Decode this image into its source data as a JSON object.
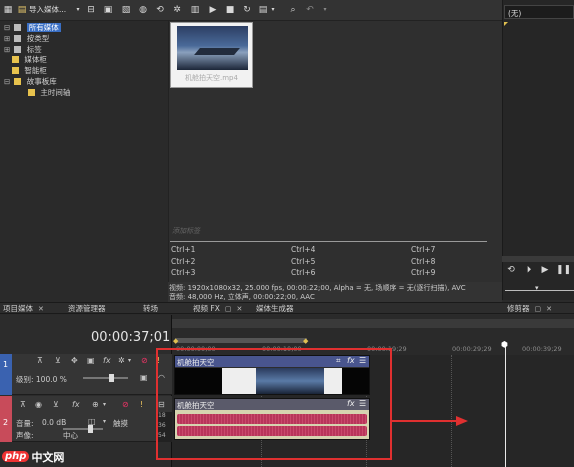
{
  "toolbar": {
    "import_label": "导入媒体...",
    "icons": [
      "media-icon",
      "import-icon",
      "view-icon",
      "props-icon",
      "effects-icon",
      "burn-icon",
      "refresh-icon",
      "settings-icon",
      "play-icon",
      "stop-icon",
      "loop-icon",
      "snap-icon",
      "grid-icon",
      "dropdown-icon",
      "search-icon",
      "undo-icon",
      "more-icon"
    ]
  },
  "media_tree": {
    "items": [
      {
        "label": "所有媒体"
      },
      {
        "label": "按类型"
      },
      {
        "label": "标签"
      },
      {
        "label": "媒体柜"
      },
      {
        "label": "智能柜"
      },
      {
        "label": "故事板库"
      },
      {
        "label": "主时间轴"
      }
    ]
  },
  "media_bin": {
    "file_name": "机舱拍天空.mp4",
    "tag_placeholder": "添加标签",
    "shortcuts": [
      "Ctrl+1",
      "Ctrl+2",
      "Ctrl+3",
      "Ctrl+4",
      "Ctrl+5",
      "Ctrl+6",
      "Ctrl+7",
      "Ctrl+8",
      "Ctrl+9"
    ],
    "info_video": "视频: 1920x1080x32, 25.000 fps, 00:00:22;00, Alpha = 无, 场顺序 = 无(逐行扫描), AVC",
    "info_audio": "音频: 48,000 Hz, 立体声, 00:00:22;00, AAC"
  },
  "preview": {
    "dropdown_value": "(无)"
  },
  "tabs": {
    "project_media": "项目媒体",
    "explorer": "资源管理器",
    "transitions": "转场",
    "video_fx": "视频 FX",
    "media_generators": "媒体生成器",
    "trimmer": "修剪器"
  },
  "timeline": {
    "timecode": "00:00:37;01",
    "ruler_labels": [
      "00:00:00;00",
      "00:00:10;00",
      "00:00:19;29",
      "00:00:29;29",
      "00:00:39;29"
    ],
    "video_track": {
      "level_label": "级别: 100.0 %",
      "track_number": "1",
      "clip_name": "机舱拍天空",
      "fx_label": "fx"
    },
    "audio_track": {
      "track_number": "2",
      "volume_label": "音量:",
      "volume_value": "0.0 dB",
      "touch_label": "触摸",
      "pan_label": "声像:",
      "pan_value": "中心",
      "clip_name": "机舱拍天空",
      "fx_label": "fx",
      "meter_labels": [
        "18",
        "36",
        "54"
      ]
    }
  },
  "watermark": {
    "label": "中文网"
  },
  "colors": {
    "highlight_red": "#e03030",
    "selected_blue": "#3366cc",
    "clip_header_video": "#49558e",
    "clip_header_audio": "#5a5a6a",
    "waveform": "#b8355a",
    "track_accent_video": "#3a62b0",
    "track_accent_audio": "#c84b5a"
  }
}
